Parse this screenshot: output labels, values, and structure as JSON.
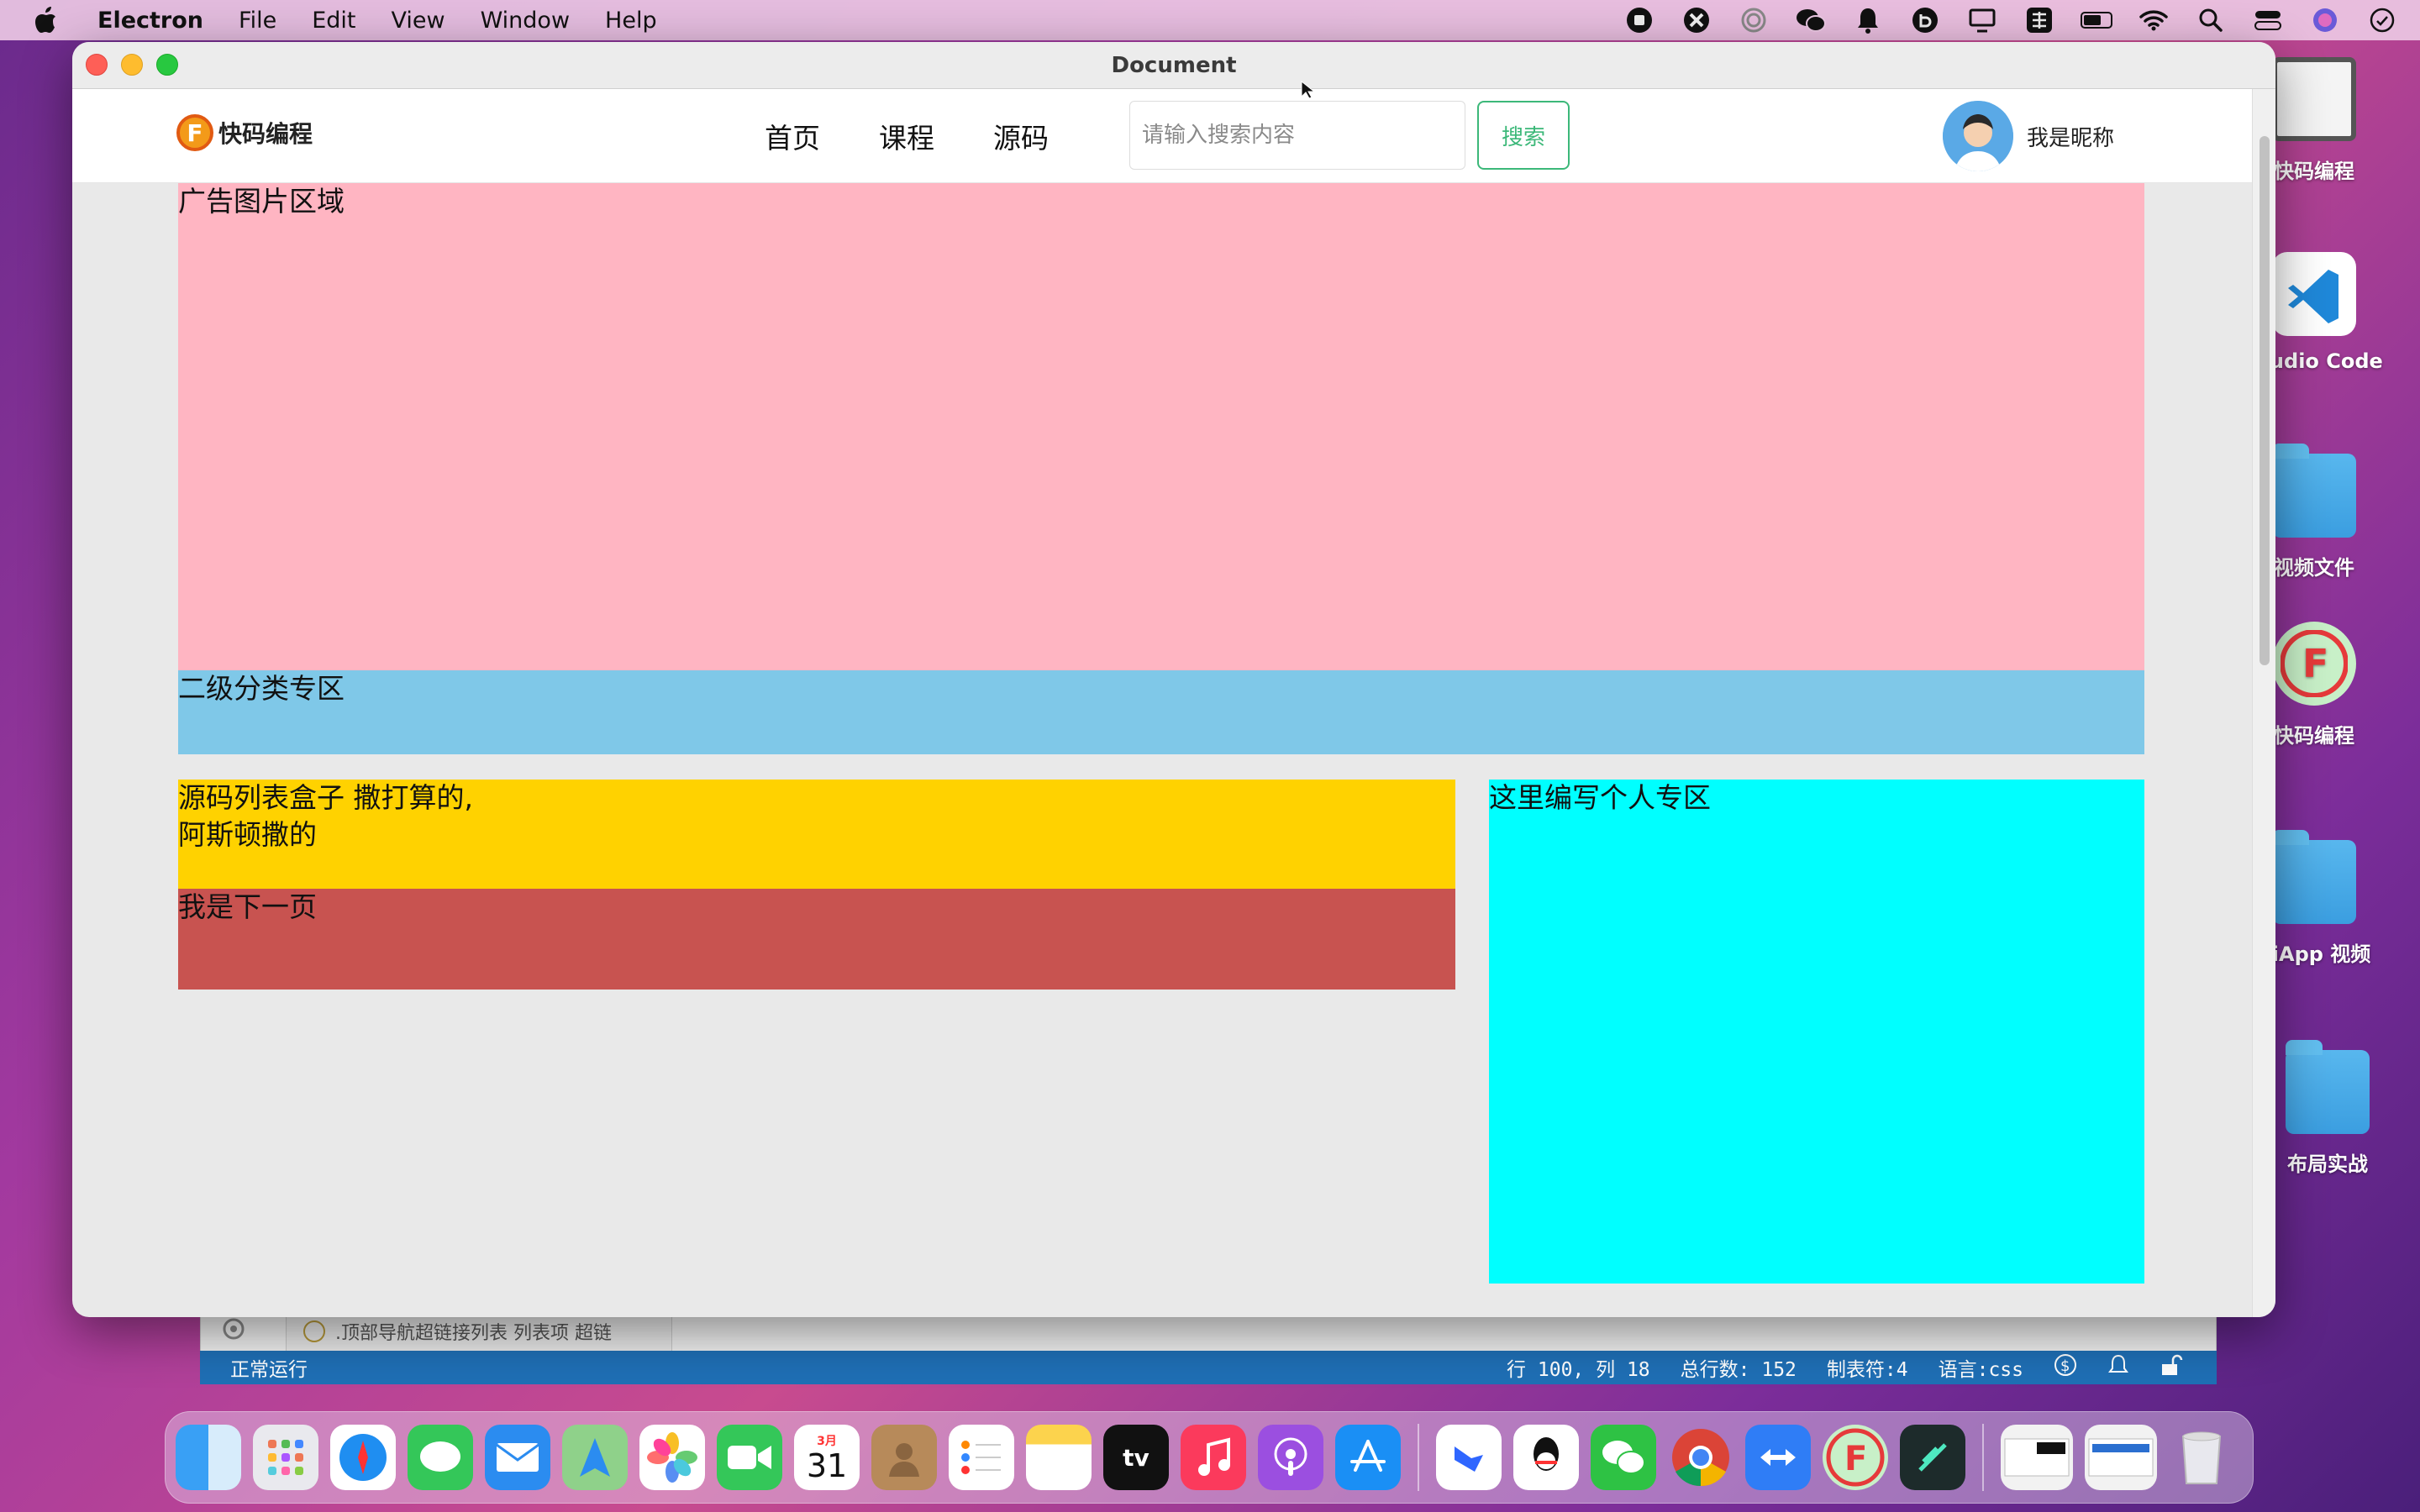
{
  "menubar": {
    "app_name": "Electron",
    "menus": [
      "File",
      "Edit",
      "View",
      "Window",
      "Help"
    ]
  },
  "desktop": {
    "items": [
      {
        "label": "快码编程",
        "icon": "file-icon"
      },
      {
        "label": "Studio Code",
        "icon": "vscode-icon"
      },
      {
        "label": "视频文件",
        "icon": "folder-icon"
      },
      {
        "label": "快码编程",
        "icon": "kuaima-app-icon"
      },
      {
        "label": "niApp 视频",
        "icon": "folder-icon"
      },
      {
        "label": "布局实战",
        "icon": "folder-icon"
      }
    ]
  },
  "editor": {
    "tab_label": ".顶部导航超链接列表 列表项 超链",
    "status_left": "正常运行",
    "status_right": {
      "position": "行 100, 列 18",
      "total": "总行数: 152",
      "tabs": "制表符:4",
      "language": "语言:css"
    }
  },
  "window": {
    "title": "Document"
  },
  "page": {
    "logo_text": "快码编程",
    "logo_mark": "F",
    "nav": [
      "首页",
      "课程",
      "源码"
    ],
    "search_placeholder": "请输入搜索内容",
    "search_button": "搜索",
    "username": "我是昵称",
    "ad_area": "广告图片区域",
    "category_area": "二级分类专区",
    "code_list_line1": "源码列表盒子 撒打算的,",
    "code_list_line2": "阿斯顿撒的",
    "next_page": "我是下一页",
    "personal_area": "这里编写个人专区"
  },
  "dock": {
    "calendar_month": "3月",
    "calendar_day": "31",
    "tv_label": "tv"
  },
  "colors": {
    "ad": "#ffb5c2",
    "category": "#7fc8e8",
    "code_list": "#ffd200",
    "next_page": "#c85350",
    "personal": "#00ffff",
    "search_accent": "#3cb879"
  }
}
